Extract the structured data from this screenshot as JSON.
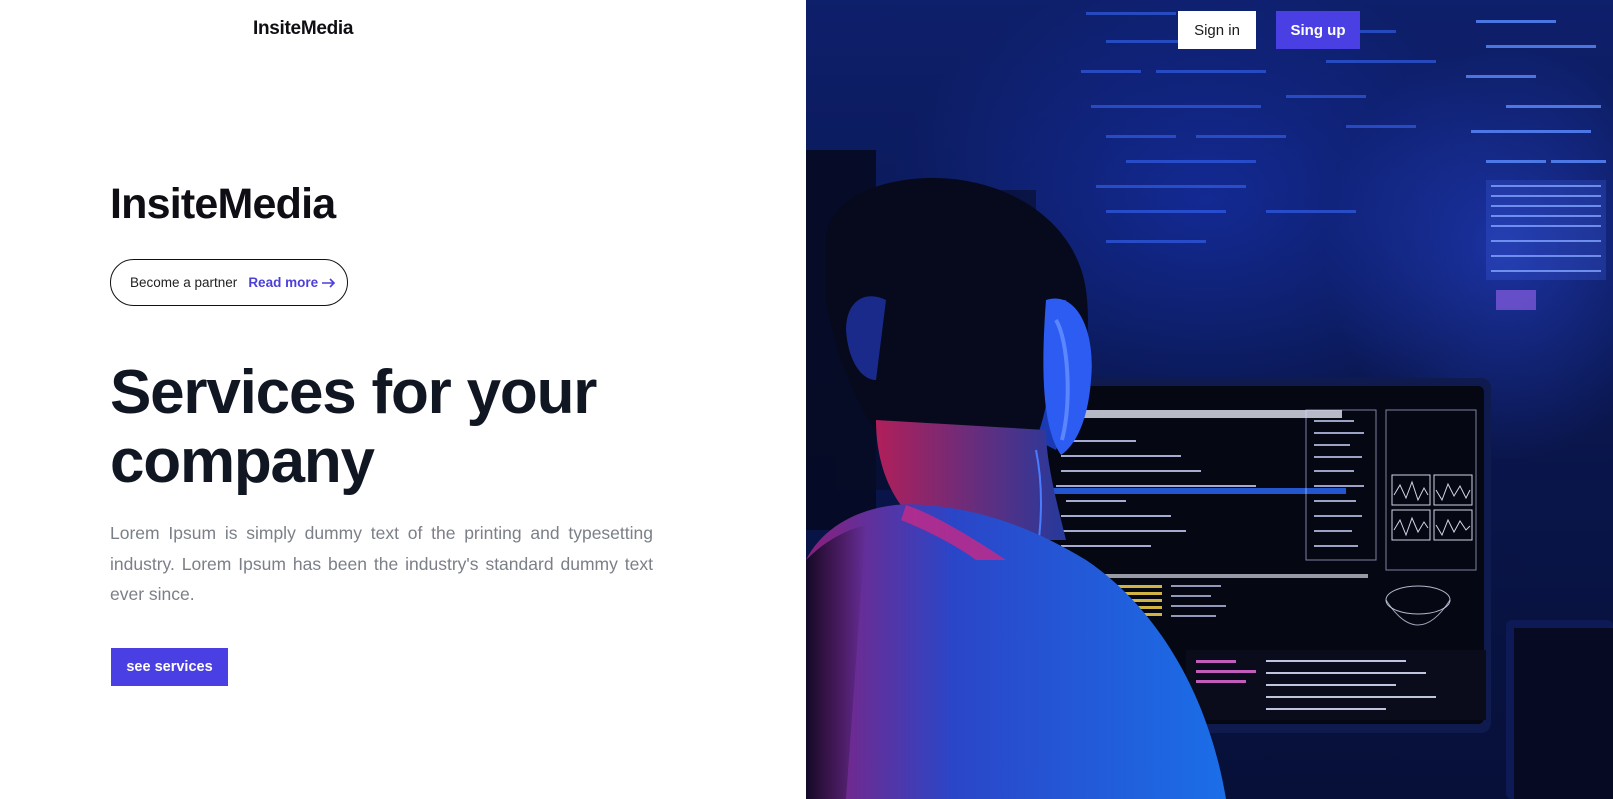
{
  "brand": {
    "nav_logo_prefix": "Insite",
    "nav_logo_m": "M",
    "nav_logo_suffix": "edia",
    "hero_logo_prefix": "Insite",
    "hero_logo_m": "M",
    "hero_logo_suffix": "edia"
  },
  "header": {
    "signin_label": "Sign in",
    "signup_label": "Sing up"
  },
  "partner": {
    "text": "Become a partner",
    "link_label": "Read more",
    "link_icon": "arrow-right-icon"
  },
  "hero": {
    "title_line1": "Services for your",
    "title_line2": "company",
    "description": "Lorem Ipsum is simply dummy text of the printing and typesetting industry. Lorem Ipsum has been the industry's standard dummy text ever since.",
    "cta_label": "see services"
  },
  "colors": {
    "accent": "#4a3fe3",
    "link": "#4c3fd8",
    "heading": "#111623",
    "body_text": "#7b7f88"
  }
}
